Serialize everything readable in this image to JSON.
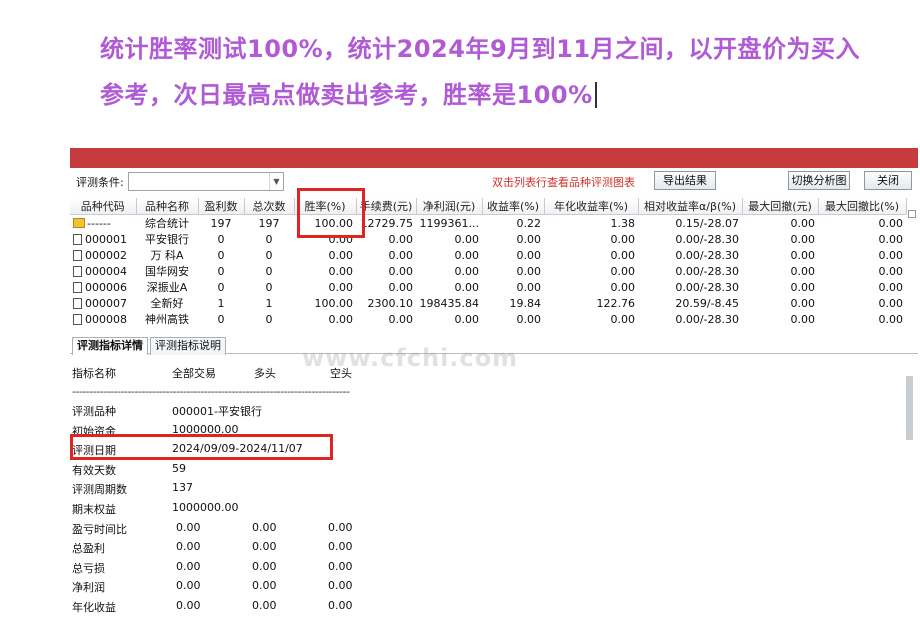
{
  "headline": {
    "line1": "统计胜率测试100%，统计2024年9月到11月之间，以开盘价为买入",
    "line2": "参考，次日最高点做卖出参考，胜率是100%"
  },
  "watermark": "www.cfchi.com",
  "toolbar": {
    "condition_label": "评测条件:",
    "condition_value": "",
    "hint": "双击列表行查看品种评测图表",
    "export_button": "导出结果",
    "switch_button": "切换分析图",
    "close_button": "关闭"
  },
  "table": {
    "columns": [
      "品种代码",
      "品种名称",
      "盈利数",
      "总次数",
      "胜率(%)",
      "手续费(元)",
      "净利润(元)",
      "收益率(%)",
      "年化收益率(%)",
      "相对收益率α/β(%)",
      "最大回撤(元)",
      "最大回撤比(%)"
    ],
    "rows": [
      {
        "icon": "folder-icon",
        "code": "------",
        "name": "综合统计",
        "wins": "197",
        "total": "197",
        "win_rate": "100.00",
        "fee": "12729.75",
        "net_profit": "1199361...",
        "return": "0.22",
        "annual": "1.38",
        "relative": "0.15/-28.07",
        "max_dd": "0.00",
        "max_dd_ratio": "0.00"
      },
      {
        "icon": "doc-icon",
        "code": "000001",
        "name": "平安银行",
        "wins": "0",
        "total": "0",
        "win_rate": "0.00",
        "fee": "0.00",
        "net_profit": "0.00",
        "return": "0.00",
        "annual": "0.00",
        "relative": "0.00/-28.30",
        "max_dd": "0.00",
        "max_dd_ratio": "0.00"
      },
      {
        "icon": "doc-icon",
        "code": "000002",
        "name": "万 科A",
        "wins": "0",
        "total": "0",
        "win_rate": "0.00",
        "fee": "0.00",
        "net_profit": "0.00",
        "return": "0.00",
        "annual": "0.00",
        "relative": "0.00/-28.30",
        "max_dd": "0.00",
        "max_dd_ratio": "0.00"
      },
      {
        "icon": "doc-icon",
        "code": "000004",
        "name": "国华网安",
        "wins": "0",
        "total": "0",
        "win_rate": "0.00",
        "fee": "0.00",
        "net_profit": "0.00",
        "return": "0.00",
        "annual": "0.00",
        "relative": "0.00/-28.30",
        "max_dd": "0.00",
        "max_dd_ratio": "0.00"
      },
      {
        "icon": "doc-icon",
        "code": "000006",
        "name": "深振业A",
        "wins": "0",
        "total": "0",
        "win_rate": "0.00",
        "fee": "0.00",
        "net_profit": "0.00",
        "return": "0.00",
        "annual": "0.00",
        "relative": "0.00/-28.30",
        "max_dd": "0.00",
        "max_dd_ratio": "0.00"
      },
      {
        "icon": "doc-icon",
        "code": "000007",
        "name": "全新好",
        "wins": "1",
        "total": "1",
        "win_rate": "100.00",
        "fee": "2300.10",
        "net_profit": "198435.84",
        "return": "19.84",
        "annual": "122.76",
        "relative": "20.59/-8.45",
        "max_dd": "0.00",
        "max_dd_ratio": "0.00"
      },
      {
        "icon": "doc-icon",
        "code": "000008",
        "name": "神州高铁",
        "wins": "0",
        "total": "0",
        "win_rate": "0.00",
        "fee": "0.00",
        "net_profit": "0.00",
        "return": "0.00",
        "annual": "0.00",
        "relative": "0.00/-28.30",
        "max_dd": "0.00",
        "max_dd_ratio": "0.00"
      }
    ]
  },
  "tabs": [
    {
      "label": "评测指标详情",
      "active": true
    },
    {
      "label": "评测指标说明",
      "active": false
    }
  ],
  "detail": {
    "header": [
      "指标名称",
      "全部交易",
      "多头",
      "空头"
    ],
    "separator": "--------------------------------------------------------------------------------",
    "rows": [
      {
        "label": "评测品种",
        "values": [
          "000001-平安银行"
        ]
      },
      {
        "label": "初始资金",
        "values": [
          "1000000.00"
        ]
      },
      {
        "label": "评测日期",
        "values": [
          "2024/09/09-2024/11/07"
        ]
      },
      {
        "label": "有效天数",
        "values": [
          "59"
        ]
      },
      {
        "label": "评测周期数",
        "values": [
          "137"
        ]
      },
      {
        "label": "期末权益",
        "values": [
          "1000000.00"
        ]
      },
      {
        "label": "盈亏时间比",
        "values": [
          "0.00",
          "0.00",
          "0.00"
        ]
      },
      {
        "label": "总盈利",
        "values": [
          "0.00",
          "0.00",
          "0.00"
        ]
      },
      {
        "label": "总亏损",
        "values": [
          "0.00",
          "0.00",
          "0.00"
        ]
      },
      {
        "label": "净利润",
        "values": [
          "0.00",
          "0.00",
          "0.00"
        ]
      },
      {
        "label": "年化收益",
        "values": [
          "0.00",
          "0.00",
          "0.00"
        ]
      }
    ]
  },
  "colors": {
    "headline": "#b05ad6",
    "title_bar": "#c63c3e",
    "highlight_box": "#e02424",
    "hint_text": "#d0312d"
  }
}
